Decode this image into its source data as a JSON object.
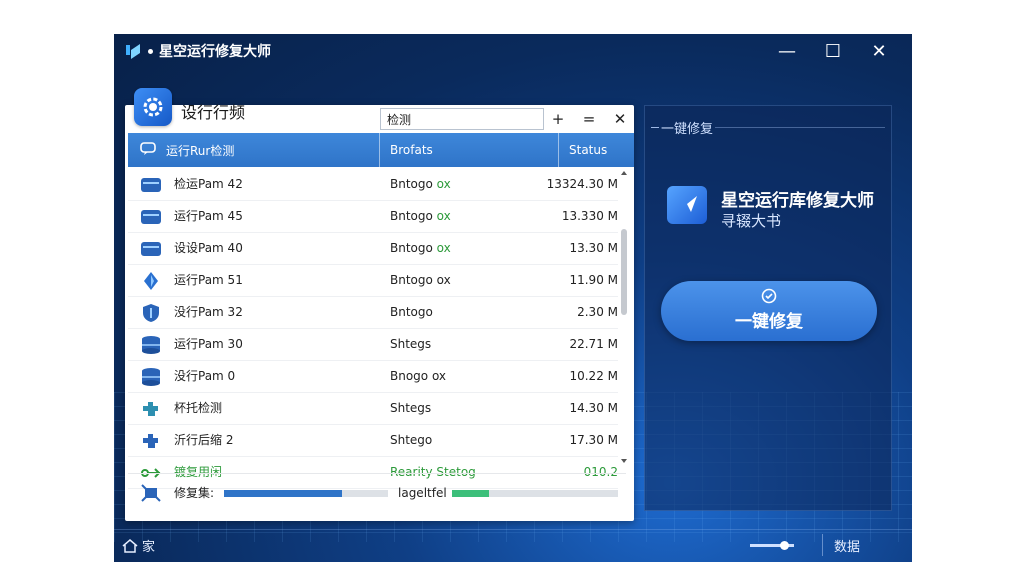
{
  "window": {
    "title": "星空运行修复大师",
    "controls": {
      "minimize": "—",
      "maximize": "☐",
      "close": "✕"
    }
  },
  "panel": {
    "title": "设行行频",
    "search_value": "检测",
    "tools": {
      "add": "+",
      "menu": "=",
      "close": "✕"
    },
    "columns": [
      "运行Rur检测",
      "Brofats",
      "Status"
    ],
    "rows": [
      {
        "icon": "drive-icon",
        "name": "检运Pam 42",
        "status": "Bntogo",
        "status_ok": "ox",
        "size": "13324.30 M"
      },
      {
        "icon": "drive-icon",
        "name": "运行Pam 45",
        "status": "Bntogo",
        "status_ok": "ox",
        "size": "13.330 M"
      },
      {
        "icon": "drive-icon",
        "name": "设设Pam 40",
        "status": "Bntogo",
        "status_ok": "ox",
        "size": "13.30 M"
      },
      {
        "icon": "diamond-icon",
        "name": "运行Pam 51",
        "status": "Bntogo ox",
        "status_ok": "",
        "size": "11.90 M"
      },
      {
        "icon": "shield-icon",
        "name": "没行Pam 32",
        "status": "Bntogo",
        "status_ok": "",
        "size": "2.30 M"
      },
      {
        "icon": "database-icon",
        "name": "运行Pam 30",
        "status": "Shtegs",
        "status_ok": "",
        "size": "22.71 M"
      },
      {
        "icon": "database-icon",
        "name": "没行Pam 0",
        "status": "Bnogo ox",
        "status_ok": "",
        "size": "10.22 M"
      },
      {
        "icon": "puzzle-icon",
        "name": "杯托检测",
        "status": "Shtegs",
        "status_ok": "",
        "size": "14.30 M"
      },
      {
        "icon": "puzzle-icon",
        "name": "沂行后缩 2",
        "status": "Shtego",
        "status_ok": "",
        "size": "17.30 M"
      },
      {
        "icon": "link-icon",
        "name": "镀复用闲",
        "status": "Rearity Stetog",
        "status_ok": "",
        "size": "010.2",
        "green": true
      }
    ],
    "footer": {
      "label": "修复集:",
      "progress_1": 0.72,
      "mid_label": "lageltfel",
      "progress_2": 0.22
    }
  },
  "side": {
    "header": "一键修复",
    "brand_title": "星空运行库修复大师",
    "brand_sub": "寻辍大书",
    "action_button": "一键修复"
  },
  "statusbar": {
    "home_label": "家",
    "right_label": "数据",
    "slider_value": 0.75
  },
  "colors": {
    "accent": "#2f74c8",
    "green": "#2c9a3a",
    "background": "#0f3f86"
  }
}
